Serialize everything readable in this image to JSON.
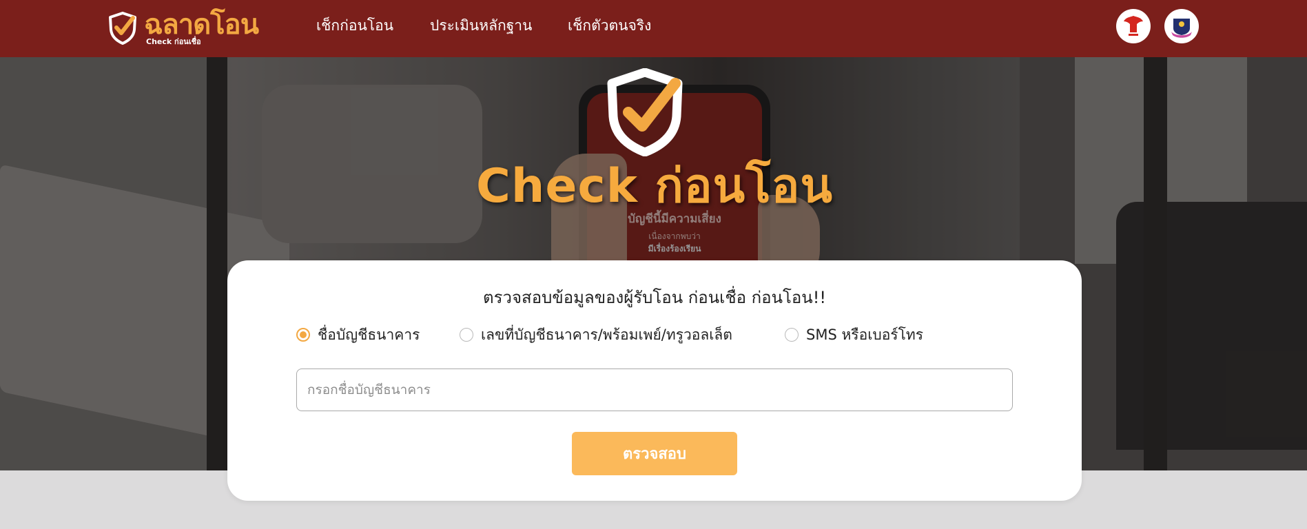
{
  "header": {
    "logo_text": "ฉลาดโอน",
    "logo_subtext": "Check ก่อนเชื่อ",
    "nav": [
      {
        "label": "เช็กก่อนโอน"
      },
      {
        "label": "ประเมินหลักฐาน"
      },
      {
        "label": "เช็กตัวตนจริง"
      }
    ]
  },
  "hero": {
    "title": "Check ก่อนโอน",
    "phone_screen_lines": [
      "บัญชีนี้มีความเสี่ยง",
      "เนื่องจากพบว่า",
      "มีเรื่องร้องเรียน"
    ]
  },
  "form": {
    "heading": "ตรวจสอบข้อมูลของผู้รับโอน ก่อนเชื่อ ก่อนโอน!!",
    "options": [
      {
        "label": "ชื่อบัญชีธนาคาร",
        "checked": true
      },
      {
        "label": "เลขที่บัญชีธนาคาร/พร้อมเพย์/ทรูวอลเล็ต",
        "checked": false
      },
      {
        "label": "SMS หรือเบอร์โทร",
        "checked": false
      }
    ],
    "input_placeholder": "กรอกชื่อบัญชีธนาคาร",
    "input_value": "",
    "submit_label": "ตรวจสอบ"
  },
  "colors": {
    "header_bg": "#7b1f1b",
    "accent": "#f3a842",
    "button_bg": "#fbb95a",
    "page_bg": "#dcdbdc"
  }
}
